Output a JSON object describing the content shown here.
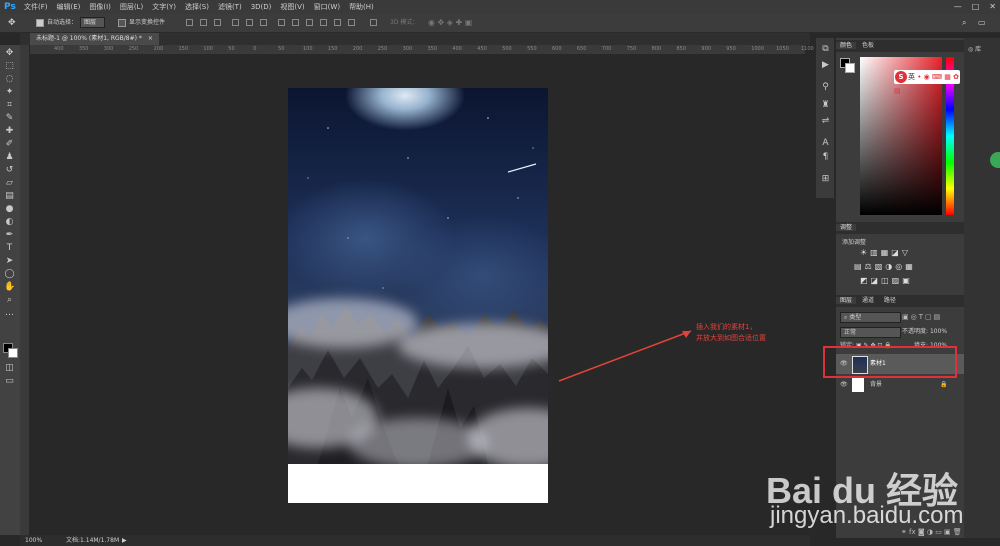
{
  "menubar": {
    "logo": "Ps",
    "items": [
      "文件(F)",
      "编辑(E)",
      "图像(I)",
      "图层(L)",
      "文字(Y)",
      "选择(S)",
      "滤镜(T)",
      "3D(D)",
      "视图(V)",
      "窗口(W)",
      "帮助(H)"
    ]
  },
  "options": {
    "auto_select_label": "自动选择：",
    "auto_select_value": "图层",
    "show_transform_label": "显示变换控件",
    "mode_3d_label": "3D 模式："
  },
  "document": {
    "tab_title": "未标题-1 @ 100% (素材1, RGB/8#) *",
    "ruler_ticks": [
      "400",
      "350",
      "300",
      "250",
      "200",
      "150",
      "100",
      "50",
      "0",
      "50",
      "100",
      "150",
      "200",
      "250",
      "300",
      "350",
      "400",
      "450",
      "500",
      "550",
      "600",
      "650",
      "700",
      "750",
      "800",
      "850",
      "900",
      "950",
      "1000",
      "1050",
      "1100"
    ]
  },
  "annotation": {
    "line1": "插入我们的素材1，",
    "line2": "并放大到如图合适位置"
  },
  "color_panel": {
    "tabs": [
      "颜色",
      "色板"
    ]
  },
  "adjust_panel": {
    "tab": "调整",
    "add_label": "添加调整"
  },
  "layers_panel": {
    "tabs": [
      "图层",
      "通道",
      "路径"
    ],
    "kind_label": "类型",
    "blend_mode": "正常",
    "opacity_label": "不透明度:",
    "opacity_value": "100%",
    "lock_label": "锁定:",
    "fill_label": "填充:",
    "fill_value": "100%",
    "layers": [
      {
        "name": "素材1"
      },
      {
        "name": "背景"
      }
    ]
  },
  "right_dock": {
    "library_label": "库"
  },
  "ime": {
    "label": "英"
  },
  "statusbar": {
    "zoom": "100%",
    "doc_info": "文档:1.14M/1.78M"
  },
  "watermark": {
    "brand": "Bai du 经验",
    "url": "jingyan.baidu.com"
  },
  "colors": {
    "accent": "#31a8ff",
    "annotation_red": "#e0433c",
    "highlight_box": "#e0313a"
  }
}
